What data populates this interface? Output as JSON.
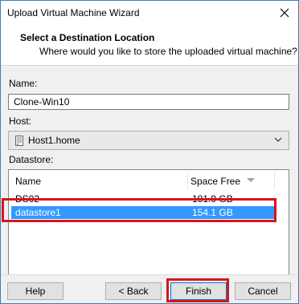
{
  "window": {
    "title": "Upload Virtual Machine Wizard"
  },
  "header": {
    "heading": "Select a Destination Location",
    "subheading": "Where would you like to store the uploaded virtual machine?"
  },
  "form": {
    "name_label": "Name:",
    "name_value": "Clone-Win10",
    "host_label": "Host:",
    "host_value": "Host1.home",
    "datastore_label": "Datastore:"
  },
  "datastore_table": {
    "columns": [
      "Name",
      "Space Free"
    ],
    "rows": [
      {
        "name": "DS02",
        "space_free": "181.9 GB",
        "selected": false
      },
      {
        "name": "datastore1",
        "space_free": "154.1 GB",
        "selected": true
      }
    ]
  },
  "buttons": {
    "help": "Help",
    "back": "< Back",
    "finish": "Finish",
    "cancel": "Cancel"
  },
  "colors": {
    "selection": "#3399ff",
    "highlight": "#d9141c",
    "window_border": "#3c7fb1"
  },
  "icons": {
    "close": "close-icon",
    "host": "host-icon",
    "dropdown": "chevron-down-icon",
    "sort": "sort-desc-icon"
  }
}
